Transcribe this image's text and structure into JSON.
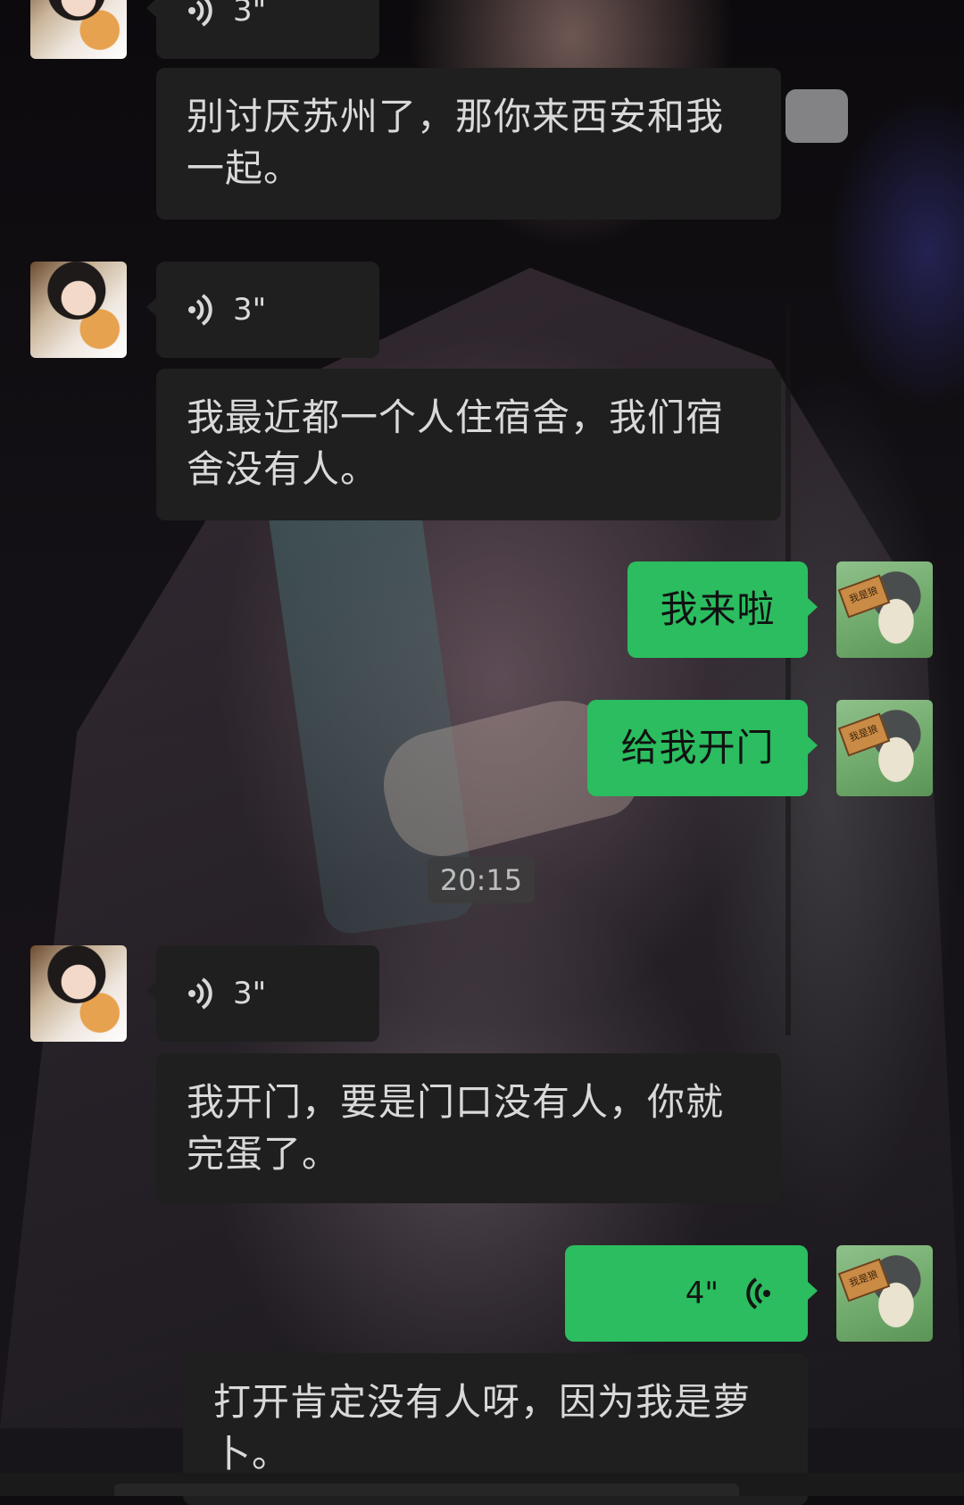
{
  "messages": [
    {
      "id": "m1",
      "side": "in",
      "kind": "voice",
      "duration": "3\""
    },
    {
      "id": "m2",
      "side": "in",
      "kind": "text",
      "lines": [
        "别讨厌苏州了，那你来西安和我",
        "一起。"
      ]
    },
    {
      "id": "m3",
      "side": "in",
      "kind": "voice",
      "duration": "3\""
    },
    {
      "id": "m4",
      "side": "in",
      "kind": "text",
      "lines": [
        "我最近都一个人住宿舍，我们宿",
        "舍没有人。"
      ]
    },
    {
      "id": "m5",
      "side": "out",
      "kind": "text",
      "text": "我来啦"
    },
    {
      "id": "m6",
      "side": "out",
      "kind": "text",
      "text": "给我开门"
    },
    {
      "id": "m7",
      "side": "in",
      "kind": "voice",
      "duration": "3\""
    },
    {
      "id": "m8",
      "side": "in",
      "kind": "text",
      "lines": [
        "我开门，要是门口没有人，你就",
        "完蛋了。"
      ]
    },
    {
      "id": "m9",
      "side": "out",
      "kind": "voice",
      "duration": "4\""
    },
    {
      "id": "m10",
      "side": "in",
      "kind": "text",
      "lines": [
        "打开肯定没有人呀，因为我是萝",
        "卜。"
      ]
    }
  ],
  "timestamp": "20:15",
  "avatar_right_sign": "我是狼",
  "colors": {
    "incoming_bubble": "#1f1f1f",
    "outgoing_bubble": "#2bbd5f",
    "incoming_text": "#d9d9d9",
    "outgoing_text": "#111111"
  },
  "icons": {
    "voice_in": "voice-wave-right-icon",
    "voice_out": "voice-wave-left-icon"
  }
}
